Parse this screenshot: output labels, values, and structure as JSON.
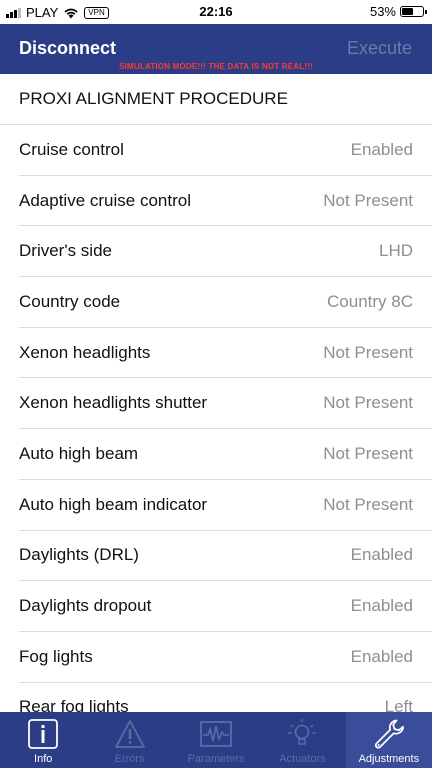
{
  "status_bar": {
    "carrier": "PLAY",
    "vpn": "VPN",
    "time": "22:16",
    "battery_percent": "53%",
    "battery_level": 0.53
  },
  "nav": {
    "left_button": "Disconnect",
    "right_button": "Execute",
    "banner": "SIMULATION MODE!!! THE DATA IS NOT REAL!!!"
  },
  "section_title": "PROXI ALIGNMENT PROCEDURE",
  "rows": [
    {
      "label": "Cruise control",
      "value": "Enabled"
    },
    {
      "label": "Adaptive cruise control",
      "value": "Not Present"
    },
    {
      "label": "Driver's side",
      "value": "LHD"
    },
    {
      "label": "Country code",
      "value": "Country 8C"
    },
    {
      "label": "Xenon headlights",
      "value": "Not Present"
    },
    {
      "label": "Xenon headlights shutter",
      "value": "Not Present"
    },
    {
      "label": "Auto high beam",
      "value": "Not Present"
    },
    {
      "label": "Auto high beam indicator",
      "value": "Not Present"
    },
    {
      "label": "Daylights (DRL)",
      "value": "Enabled"
    },
    {
      "label": "Daylights dropout",
      "value": "Enabled"
    },
    {
      "label": "Fog lights",
      "value": "Enabled"
    },
    {
      "label": "Rear fog lights",
      "value": "Left"
    }
  ],
  "tabs": [
    {
      "label": "Info",
      "icon": "info-icon"
    },
    {
      "label": "Errors",
      "icon": "warning-icon"
    },
    {
      "label": "Parameters",
      "icon": "chart-icon"
    },
    {
      "label": "Actuators",
      "icon": "lightbulb-icon"
    },
    {
      "label": "Adjustments",
      "icon": "wrench-icon"
    }
  ],
  "colors": {
    "nav_background": "#2b3d86",
    "banner_text": "#ff3b30",
    "value_text": "#8e8e93",
    "inactive_tab": "#5c6ca3"
  }
}
